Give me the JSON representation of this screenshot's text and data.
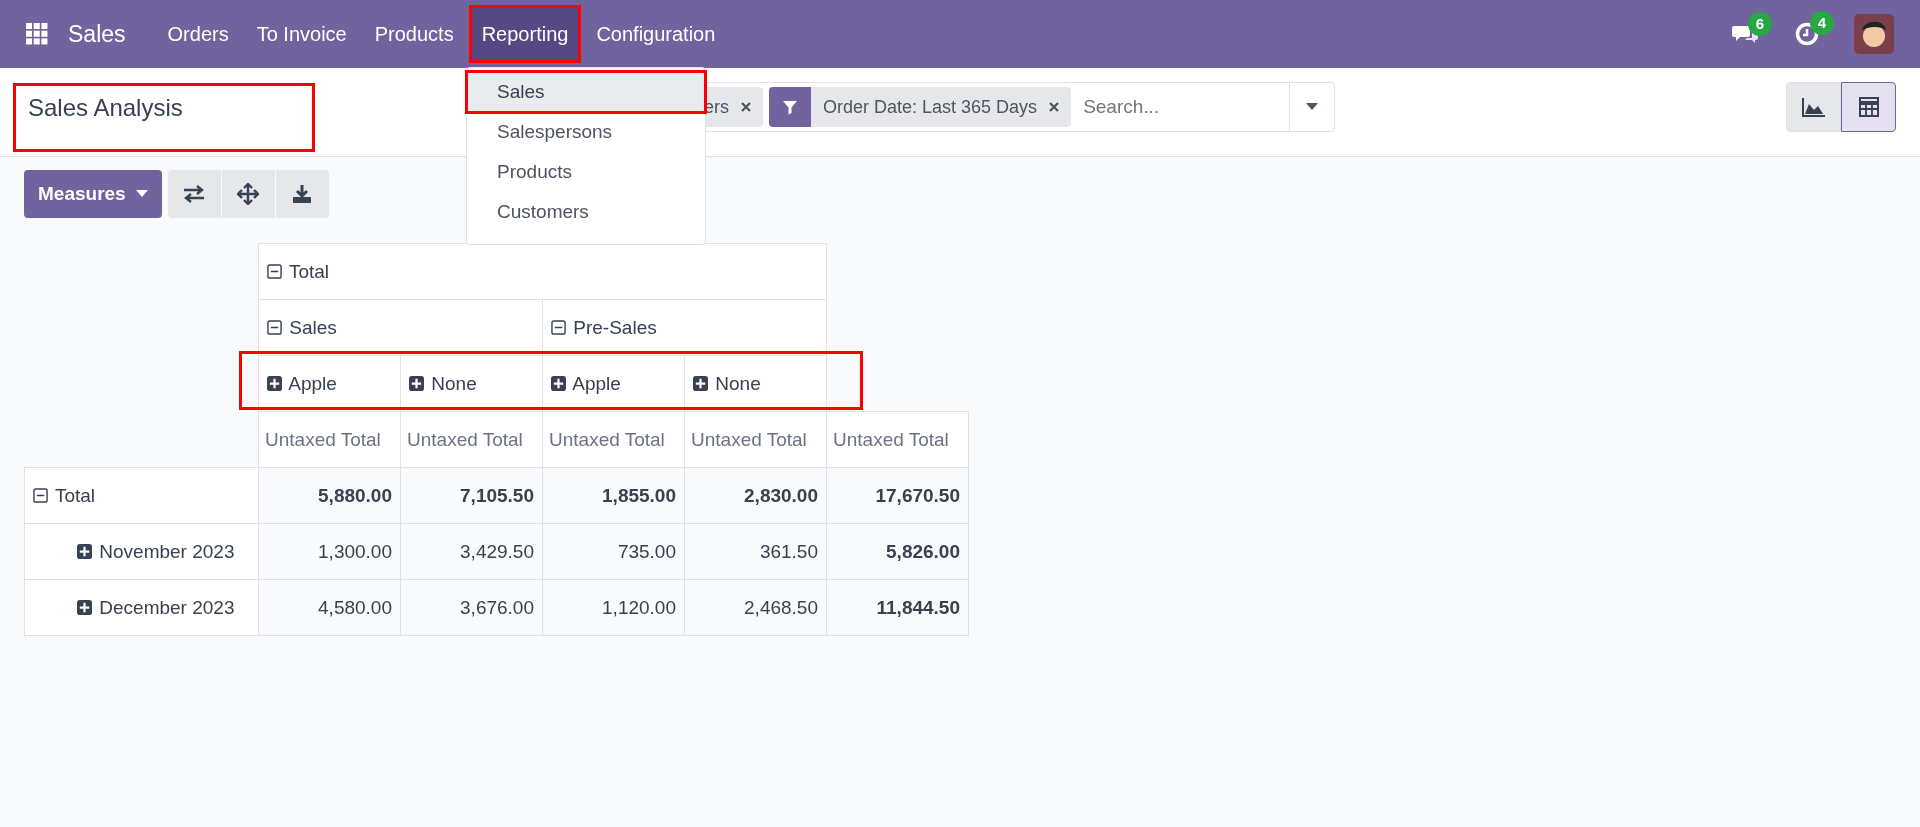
{
  "navbar": {
    "app": "Sales",
    "menu": [
      {
        "label": "Orders",
        "selected": false,
        "highlighted": false
      },
      {
        "label": "To Invoice",
        "selected": false,
        "highlighted": false
      },
      {
        "label": "Products",
        "selected": false,
        "highlighted": false
      },
      {
        "label": "Reporting",
        "selected": true,
        "highlighted": true
      },
      {
        "label": "Configuration",
        "selected": false,
        "highlighted": false
      }
    ],
    "messages_badge": "6",
    "activities_badge": "4"
  },
  "dropdown": {
    "items": [
      {
        "label": "Sales",
        "selected": true,
        "highlighted": true
      },
      {
        "label": "Salespersons",
        "selected": false,
        "highlighted": false
      },
      {
        "label": "Products",
        "selected": false,
        "highlighted": false
      },
      {
        "label": "Customers",
        "selected": false,
        "highlighted": false
      }
    ]
  },
  "breadcrumb": {
    "label": "Sales Analysis",
    "highlighted": true
  },
  "search": {
    "facets": [
      {
        "kind": "group",
        "label": "ers"
      },
      {
        "kind": "filter",
        "label": "Order Date: Last 365 Days"
      }
    ],
    "placeholder": "Search..."
  },
  "views": [
    {
      "kind": "graph",
      "selected": false
    },
    {
      "kind": "pivot",
      "selected": true
    }
  ],
  "measures_button": "Measures",
  "pivot": {
    "col_header": {
      "label": "Total",
      "expanded": true,
      "children": [
        {
          "label": "Sales",
          "expanded": true,
          "children": [
            {
              "label": "Apple",
              "expanded": false
            },
            {
              "label": "None",
              "expanded": false
            }
          ]
        },
        {
          "label": "Pre-Sales",
          "expanded": true,
          "children": [
            {
              "label": "Apple",
              "expanded": false
            },
            {
              "label": "None",
              "expanded": false
            }
          ]
        }
      ]
    },
    "leaf_row_highlighted": true,
    "measure_headers": [
      "Untaxed Total",
      "Untaxed Total",
      "Untaxed Total",
      "Untaxed Total",
      "Untaxed Total"
    ],
    "rows": [
      {
        "label": "Total",
        "expanded": true,
        "values": [
          "5,880.00",
          "7,105.50",
          "1,855.00",
          "2,830.00",
          "17,670.50"
        ],
        "children": [
          {
            "label": "November 2023",
            "expanded": false,
            "values": [
              "1,300.00",
              "3,429.50",
              "735.00",
              "361.50",
              "5,826.00"
            ]
          },
          {
            "label": "December 2023",
            "expanded": false,
            "values": [
              "4,580.00",
              "3,676.00",
              "1,120.00",
              "2,468.50",
              "11,844.50"
            ]
          }
        ]
      }
    ]
  }
}
